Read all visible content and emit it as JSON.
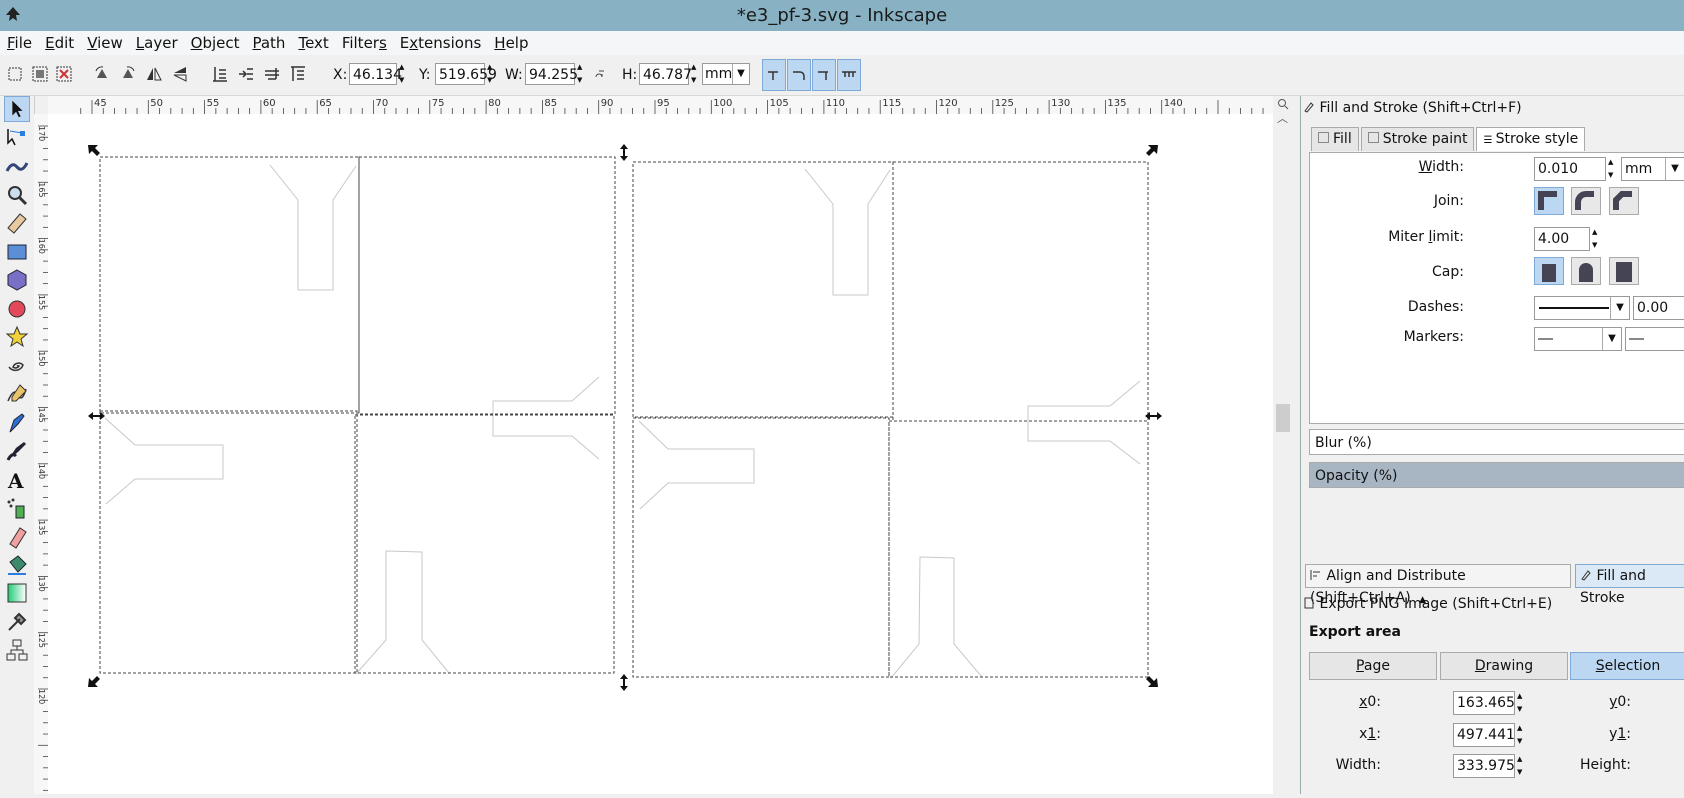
{
  "window": {
    "title": "*e3_pf-3.svg - Inkscape"
  },
  "menu": [
    {
      "pre": "",
      "ul": "F",
      "post": "ile"
    },
    {
      "pre": "",
      "ul": "E",
      "post": "dit"
    },
    {
      "pre": "",
      "ul": "V",
      "post": "iew"
    },
    {
      "pre": "",
      "ul": "L",
      "post": "ayer"
    },
    {
      "pre": "",
      "ul": "O",
      "post": "bject"
    },
    {
      "pre": "",
      "ul": "P",
      "post": "ath"
    },
    {
      "pre": "",
      "ul": "T",
      "post": "ext"
    },
    {
      "pre": "Filter",
      "ul": "s",
      "post": ""
    },
    {
      "pre": "E",
      "ul": "x",
      "post": "tensions"
    },
    {
      "pre": "",
      "ul": "H",
      "post": "elp"
    }
  ],
  "toolbar": {
    "x_label": "X:",
    "x_value": "46.134",
    "y_label": "Y:",
    "y_value": "519.659",
    "w_label": "W:",
    "w_value": "94.255",
    "h_label": "H:",
    "h_value": "46.787",
    "unit": "mm"
  },
  "ruler": {
    "top": [
      "45",
      "50",
      "55",
      "60",
      "65",
      "70",
      "75",
      "80",
      "85",
      "90",
      "95",
      "100",
      "105",
      "110",
      "115",
      "120",
      "125",
      "130",
      "135",
      "140"
    ],
    "left": [
      "170",
      "165",
      "160",
      "155",
      "150",
      "145",
      "140",
      "135",
      "130",
      "125",
      "120"
    ]
  },
  "fill_stroke": {
    "header": "Fill and Stroke (Shift+Ctrl+F)",
    "tabs": {
      "fill": "Fill",
      "stroke_paint": "Stroke paint",
      "stroke_style": "Stroke style"
    },
    "width": {
      "pre": "",
      "ul": "W",
      "post": "idth:",
      "value": "0.010",
      "unit": "mm"
    },
    "join_label": "Join:",
    "miter": {
      "pre": "Miter ",
      "ul": "l",
      "post": "imit:",
      "value": "4.00"
    },
    "cap_label": "Cap:",
    "dashes": {
      "label": "Dashes:",
      "value": "0.00"
    },
    "markers_label": "Markers:",
    "blur_label": "Blur (%)",
    "opacity_label": "Opacity (%)"
  },
  "dock_tabs": {
    "align": "Align and Distribute (Shift+Ctrl+A)",
    "fill_stroke": "Fill and Stroke"
  },
  "export": {
    "header": "Export PNG Image (Shift+Ctrl+E)",
    "area_title": "Export area",
    "page": {
      "pre": "",
      "ul": "P",
      "post": "age"
    },
    "drawing": {
      "pre": "",
      "ul": "D",
      "post": "rawing"
    },
    "selection": {
      "pre": "",
      "ul": "S",
      "post": "election"
    },
    "x0": {
      "pre": "",
      "ul": "x",
      "post": "0:",
      "value": "163.465"
    },
    "x1": {
      "pre": "x",
      "ul": "1",
      "post": ":",
      "value": "497.441"
    },
    "width": {
      "label": "Width:",
      "value": "333.975"
    },
    "y0": {
      "pre": "",
      "ul": "y",
      "post": "0:"
    },
    "y1": {
      "pre": "y",
      "ul": "1",
      "post": ":"
    },
    "height": {
      "label": "Height:"
    }
  }
}
